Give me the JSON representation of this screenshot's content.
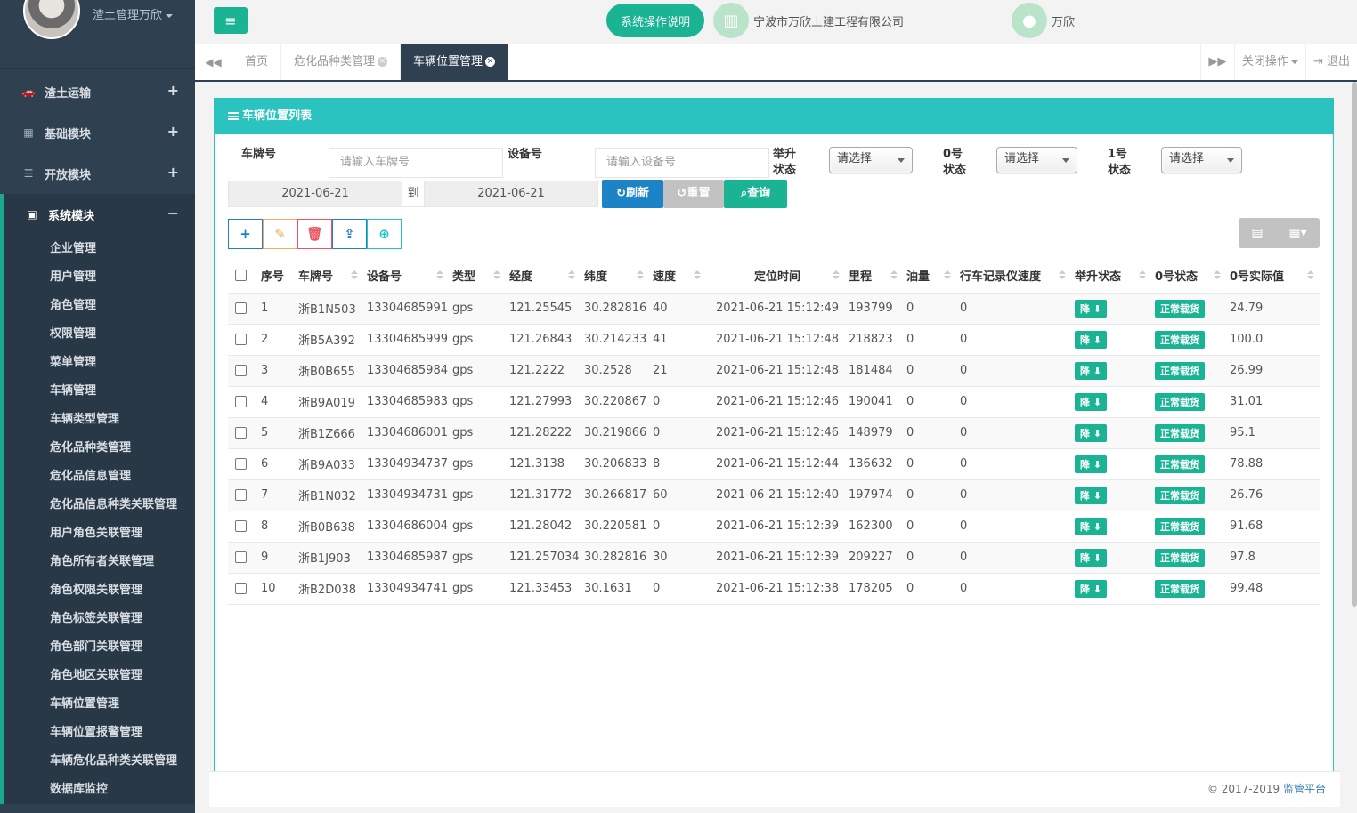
{
  "sidebar": {
    "profile_name": "渣土管理万欣",
    "menu": [
      {
        "label": "渣土运输",
        "icon": "car-icon"
      },
      {
        "label": "基础模块",
        "icon": "qrcode-icon"
      },
      {
        "label": "开放模块",
        "icon": "list-icon"
      },
      {
        "label": "系统模块",
        "icon": "square-icon"
      }
    ],
    "sub_items": [
      "企业管理",
      "用户管理",
      "角色管理",
      "权限管理",
      "菜单管理",
      "车辆管理",
      "车辆类型管理",
      "危化品种类管理",
      "危化品信息管理",
      "危化品信息种类关联管理",
      "用户角色关联管理",
      "角色所有者关联管理",
      "角色权限关联管理",
      "角色标签关联管理",
      "角色部门关联管理",
      "角色地区关联管理",
      "车辆位置管理",
      "车辆位置报警管理",
      "车辆危化品种类关联管理",
      "数据库监控"
    ]
  },
  "topbar": {
    "help": "系统操作说明",
    "company": "宁波市万欣土建工程有限公司",
    "user": "万欣"
  },
  "tabs": {
    "items": [
      "首页",
      "危化品种类管理",
      "车辆位置管理"
    ],
    "close_ops": "关闭操作",
    "logout": "退出"
  },
  "panel": {
    "title": "车辆位置列表"
  },
  "filters": {
    "plate_label": "车牌号",
    "plate_placeholder": "请输入车牌号",
    "device_label": "设备号",
    "device_placeholder": "请输入设备号",
    "lift_label": "举升状态",
    "zero_label": "0号状态",
    "one_label": "1号状态",
    "select_text": "请选择",
    "date_from": "2021-06-21",
    "date_to_label": "到",
    "date_to": "2021-06-21",
    "refresh": "刷新",
    "reset": "重置",
    "query": "查询"
  },
  "table": {
    "columns": [
      "序号",
      "车牌号",
      "设备号",
      "类型",
      "经度",
      "纬度",
      "速度",
      "定位时间",
      "里程",
      "油量",
      "行车记录仪速度",
      "举升状态",
      "0号状态",
      "0号实际值"
    ],
    "lift_badge": "降",
    "zero_badge": "正常载货",
    "rows": [
      [
        "1",
        "浙B1N503",
        "13304685991",
        "gps",
        "121.25545",
        "30.282816",
        "40",
        "2021-06-21 15:12:49",
        "193799",
        "0",
        "0",
        "24.79"
      ],
      [
        "2",
        "浙B5A392",
        "13304685999",
        "gps",
        "121.26843",
        "30.214233",
        "41",
        "2021-06-21 15:12:48",
        "218823",
        "0",
        "0",
        "100.0"
      ],
      [
        "3",
        "浙B0B655",
        "13304685984",
        "gps",
        "121.2222",
        "30.2528",
        "21",
        "2021-06-21 15:12:48",
        "181484",
        "0",
        "0",
        "26.99"
      ],
      [
        "4",
        "浙B9A019",
        "13304685983",
        "gps",
        "121.27993",
        "30.220867",
        "0",
        "2021-06-21 15:12:46",
        "190041",
        "0",
        "0",
        "31.01"
      ],
      [
        "5",
        "浙B1Z666",
        "13304686001",
        "gps",
        "121.28222",
        "30.219866",
        "0",
        "2021-06-21 15:12:46",
        "148979",
        "0",
        "0",
        "95.1"
      ],
      [
        "6",
        "浙B9A033",
        "13304934737",
        "gps",
        "121.3138",
        "30.206833",
        "8",
        "2021-06-21 15:12:44",
        "136632",
        "0",
        "0",
        "78.88"
      ],
      [
        "7",
        "浙B1N032",
        "13304934731",
        "gps",
        "121.31772",
        "30.266817",
        "60",
        "2021-06-21 15:12:40",
        "197974",
        "0",
        "0",
        "26.76"
      ],
      [
        "8",
        "浙B0B638",
        "13304686004",
        "gps",
        "121.28042",
        "30.220581",
        "0",
        "2021-06-21 15:12:39",
        "162300",
        "0",
        "0",
        "91.68"
      ],
      [
        "9",
        "浙B1J903",
        "13304685987",
        "gps",
        "121.257034",
        "30.282816",
        "30",
        "2021-06-21 15:12:39",
        "209227",
        "0",
        "0",
        "97.8"
      ],
      [
        "10",
        "浙B2D038",
        "13304934741",
        "gps",
        "121.33453",
        "30.1631",
        "0",
        "2021-06-21 15:12:38",
        "178205",
        "0",
        "0",
        "99.48"
      ]
    ]
  },
  "footer": {
    "copyright": "© 2017-2019 ",
    "link": "监管平台"
  },
  "colors": {
    "sidebar_bg": "#2f4050",
    "accent_green": "#1ab394",
    "panel_teal": "#2bc3c0",
    "primary_blue": "#1c84c6"
  }
}
